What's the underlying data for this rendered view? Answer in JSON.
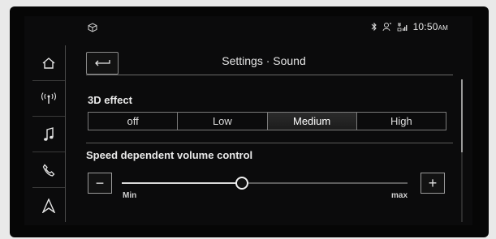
{
  "status": {
    "time": "10:50",
    "ampm": "AM"
  },
  "header": {
    "title": "Settings · Sound"
  },
  "sidebar": {
    "items": [
      "home-icon",
      "radio-icon",
      "music-icon",
      "phone-icon",
      "navigation-icon"
    ]
  },
  "effect3d": {
    "label": "3D effect",
    "options": [
      "off",
      "Low",
      "Medium",
      "High"
    ],
    "selected": "Medium"
  },
  "speed_volume": {
    "label": "Speed dependent volume control",
    "min_label": "Min",
    "max_label": "max",
    "minus": "−",
    "plus": "+",
    "level": 0.42
  },
  "colors": {
    "accent": "#ffffff",
    "background": "#0b0b0c",
    "border": "#7a7a7a"
  }
}
